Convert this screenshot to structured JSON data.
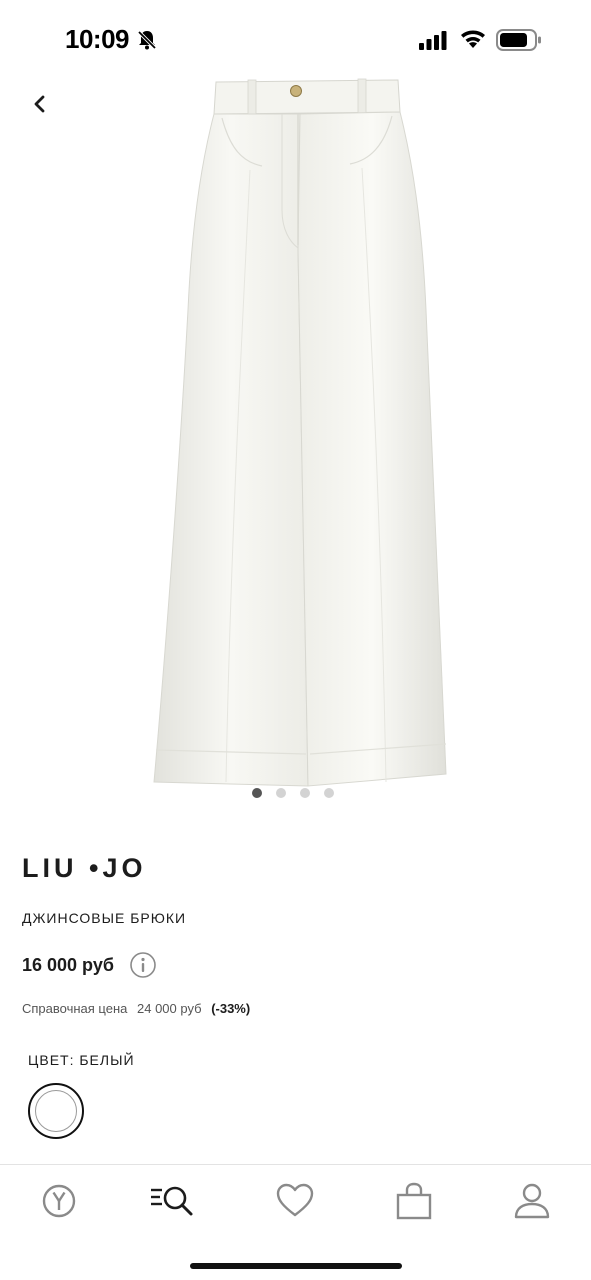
{
  "status_bar": {
    "time": "10:09",
    "icons": [
      "bell-slash-icon",
      "signal-icon",
      "wifi-icon",
      "battery-icon"
    ]
  },
  "navigation": {
    "back_icon": "chevron-left-icon"
  },
  "product": {
    "image": "white wide-leg jeans",
    "image_count": 4,
    "active_image": 1,
    "brand": "LIU •JO",
    "category": "ДЖИНСОВЫЕ БРЮКИ",
    "price": "16 000 руб",
    "reference_label": "Справочная цена",
    "reference_price": "24 000 руб",
    "discount": "(-33%)",
    "color_label": "ЦВЕТ: БЕЛЫЙ",
    "color_swatch": "#ffffff"
  },
  "tab_bar": {
    "tabs": [
      "home-logo-icon",
      "search-menu-icon",
      "heart-icon",
      "shopping-bag-icon",
      "profile-icon"
    ]
  },
  "colors": {
    "text": "#1c1c1c",
    "muted": "#555555",
    "icon_gray": "#8a8a8a",
    "dot_active": "#555555",
    "dot_inactive": "#d3d3d3"
  }
}
